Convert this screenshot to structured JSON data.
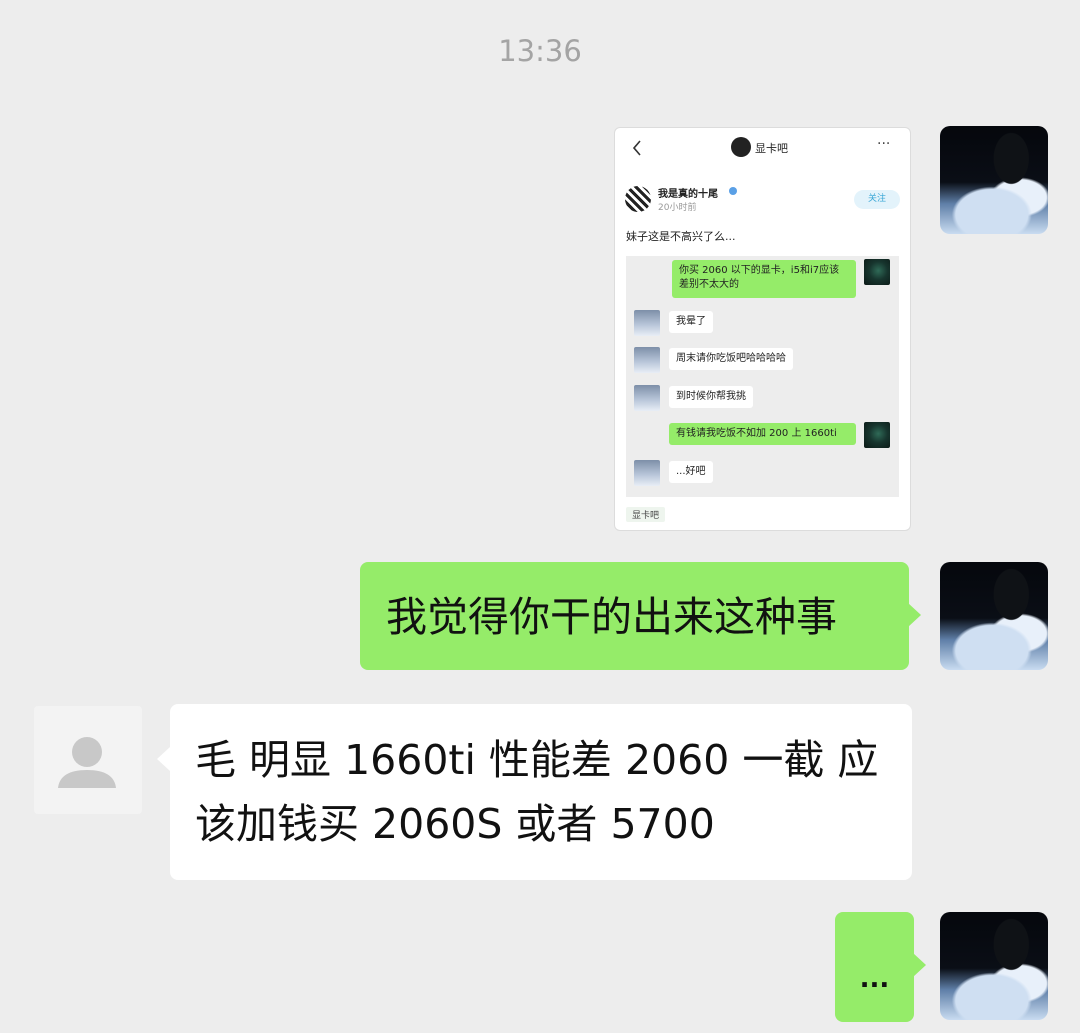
{
  "timestamp": "13:36",
  "shared_screenshot": {
    "header_title": "显卡吧",
    "poster_name": "我是真的十尾",
    "post_time": "20小时前",
    "follow_label": "关注",
    "post_text": "妹子这是不高兴了么...",
    "inner_chat": [
      {
        "side": "right",
        "text": "你买 2060 以下的显卡，i5和i7应该差别不太大的"
      },
      {
        "side": "left",
        "text": "我晕了"
      },
      {
        "side": "left",
        "text": "周末请你吃饭吧哈哈哈哈"
      },
      {
        "side": "left",
        "text": "到时候你帮我挑"
      },
      {
        "side": "right",
        "text": "有钱请我吃饭不如加 200 上 1660ti"
      },
      {
        "side": "left",
        "text": "...好吧"
      }
    ],
    "forum_tag": "显卡吧"
  },
  "messages": [
    {
      "side": "right",
      "text": "我觉得你干的出来这种事"
    },
    {
      "side": "left",
      "text": "毛 明显 1660ti 性能差 2060 一截 应该加钱买 2060S 或者 5700"
    },
    {
      "side": "right",
      "text": "..."
    }
  ]
}
